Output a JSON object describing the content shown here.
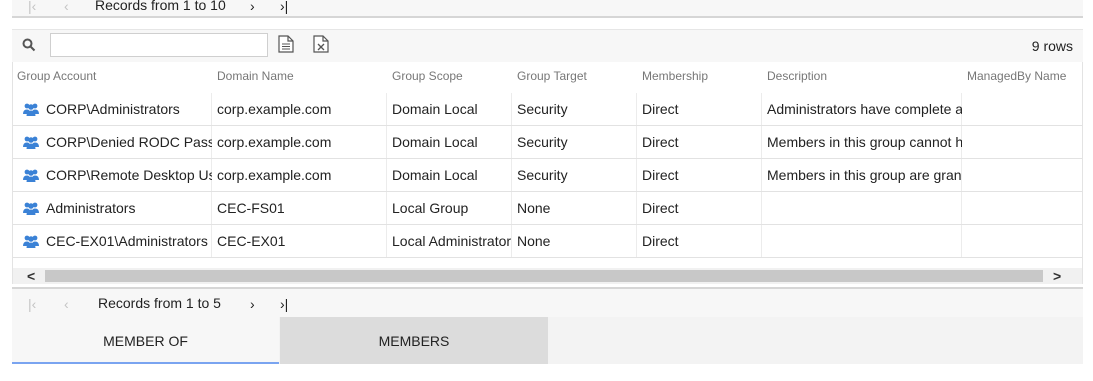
{
  "top_pager": {
    "records_text": "Records from 1 to 10"
  },
  "toolbar": {
    "search_value": "",
    "export_doc_icon": "document-icon",
    "export_excel_icon": "excel-icon",
    "row_count": "9 rows"
  },
  "grid": {
    "columns": [
      "Group Account",
      "Domain Name",
      "Group Scope",
      "Group Target",
      "Membership",
      "Description",
      "ManagedBy Name"
    ],
    "rows": [
      {
        "account": "CORP\\Administrators",
        "domain": "corp.example.com",
        "scope": "Domain Local",
        "target": "Security",
        "membership": "Direct",
        "description": "Administrators have complete a",
        "managed_by": ""
      },
      {
        "account": "CORP\\Denied RODC Pass",
        "domain": "corp.example.com",
        "scope": "Domain Local",
        "target": "Security",
        "membership": "Direct",
        "description": "Members in this group cannot h",
        "managed_by": ""
      },
      {
        "account": "CORP\\Remote Desktop Us",
        "domain": "corp.example.com",
        "scope": "Domain Local",
        "target": "Security",
        "membership": "Direct",
        "description": "Members in this group are gran",
        "managed_by": ""
      },
      {
        "account": "Administrators",
        "domain": "CEC-FS01",
        "scope": "Local Group",
        "target": "None",
        "membership": "Direct",
        "description": "",
        "managed_by": ""
      },
      {
        "account": "CEC-EX01\\Administrators",
        "domain": "CEC-EX01",
        "scope": "Local Administrator",
        "target": "None",
        "membership": "Direct",
        "description": "",
        "managed_by": ""
      }
    ],
    "row_icon": "group-icon",
    "accent_color": "#3b82d6"
  },
  "bottom_pager": {
    "records_text": "Records from 1 to 5"
  },
  "tabs": [
    {
      "label": "MEMBER OF",
      "active": true
    },
    {
      "label": "MEMBERS",
      "active": false
    }
  ]
}
